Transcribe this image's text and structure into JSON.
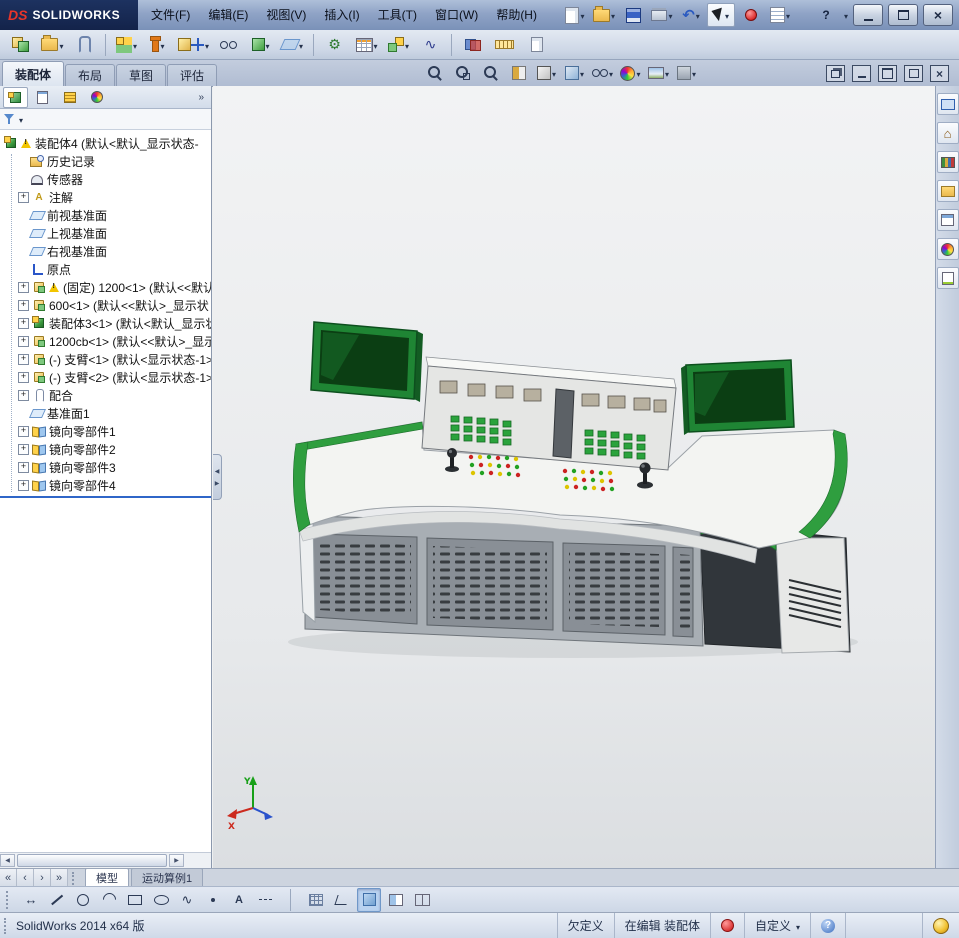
{
  "titlebar": {
    "logo_mark": "DS",
    "brand": "SOLIDWORKS",
    "menus": [
      {
        "label": "文件(F)"
      },
      {
        "label": "编辑(E)"
      },
      {
        "label": "视图(V)"
      },
      {
        "label": "插入(I)"
      },
      {
        "label": "工具(T)"
      },
      {
        "label": "窗口(W)"
      },
      {
        "label": "帮助(H)"
      }
    ]
  },
  "quick_toolbar": {
    "icons": [
      "new-document",
      "open-document",
      "save",
      "print",
      "undo",
      "select",
      "record-macro",
      "options-list"
    ]
  },
  "assembly_toolbar": {
    "icons": [
      "edit-component",
      "insert-components",
      "mate",
      "linear-component-pattern",
      "smart-fasteners",
      "move-component",
      "show-hidden-components",
      "assembly-features",
      "reference-geometry",
      "new-motion-study",
      "bill-of-materials",
      "exploded-view",
      "explode-line-sketch",
      "interference-detection",
      "measure",
      "performance-evaluation"
    ]
  },
  "command_tabs": {
    "tabs": [
      {
        "label": "装配体",
        "active": true
      },
      {
        "label": "布局",
        "active": false
      },
      {
        "label": "草图",
        "active": false
      },
      {
        "label": "评估",
        "active": false
      }
    ]
  },
  "headsup": {
    "icons": [
      "zoom-to-fit",
      "zoom-to-area",
      "previous-view",
      "section-view",
      "view-orientation",
      "display-style",
      "hide-show-items",
      "edit-appearance",
      "apply-scene",
      "view-settings"
    ]
  },
  "viewport_window_buttons": [
    "restore-window",
    "minimize-window",
    "maximize-window",
    "float-window",
    "close-window"
  ],
  "feature_panel": {
    "tabs": [
      "featuremanager",
      "propertymanager",
      "configurationmanager",
      "displaymanager"
    ],
    "tree": [
      {
        "text": "装配体4 (默认<默认_显示状态-",
        "icon": "assembly",
        "warning": true
      },
      {
        "text": "历史记录",
        "icon": "history"
      },
      {
        "text": "传感器",
        "icon": "sensors"
      },
      {
        "text": "注解",
        "icon": "annotations",
        "expandable": true
      },
      {
        "text": "前视基准面",
        "icon": "plane"
      },
      {
        "text": "上视基准面",
        "icon": "plane"
      },
      {
        "text": "右视基准面",
        "icon": "plane"
      },
      {
        "text": "原点",
        "icon": "origin"
      },
      {
        "text": "(固定) 1200<1> (默认<<默认",
        "icon": "part",
        "warning": true,
        "expandable": true
      },
      {
        "text": "600<1> (默认<<默认>_显示状",
        "icon": "part",
        "expandable": true
      },
      {
        "text": "装配体3<1> (默认<默认_显示状",
        "icon": "assembly",
        "expandable": true
      },
      {
        "text": "1200cb<1> (默认<<默认>_显示",
        "icon": "part",
        "expandable": true
      },
      {
        "text": "(-) 支臂<1> (默认<显示状态-1>",
        "icon": "part",
        "expandable": true
      },
      {
        "text": "(-) 支臂<2> (默认<显示状态-1>",
        "icon": "part",
        "expandable": true
      },
      {
        "text": "配合",
        "icon": "mates",
        "expandable": true
      },
      {
        "text": "基准面1",
        "icon": "plane"
      },
      {
        "text": "镜向零部件1",
        "icon": "mirror",
        "expandable": true
      },
      {
        "text": "镜向零部件2",
        "icon": "mirror",
        "expandable": true
      },
      {
        "text": "镜向零部件3",
        "icon": "mirror",
        "expandable": true
      },
      {
        "text": "镜向零部件4",
        "icon": "mirror",
        "expandable": true
      }
    ]
  },
  "task_pane": {
    "icons": [
      "solidworks-resources",
      "home",
      "design-library",
      "file-explorer",
      "view-palette",
      "appearances-scenes",
      "custom-properties"
    ]
  },
  "triad": {
    "x": "X",
    "y": "Y"
  },
  "bottom": {
    "tabs": [
      {
        "label": "模型",
        "active": true
      },
      {
        "label": "运动算例1",
        "active": false
      }
    ],
    "sketch_icons": [
      "smart-dimension",
      "line",
      "circle",
      "arc",
      "rectangle",
      "ellipse",
      "spline",
      "point",
      "text",
      "centerline",
      "grid",
      "angle-snap",
      "shaded-sketch-contours",
      "section-view",
      "two-pane-view"
    ],
    "pressed": [
      "shaded-sketch-contours"
    ]
  },
  "statusbar": {
    "app": "SolidWorks 2014 x64 版",
    "state": "欠定义",
    "editing": "在编辑 装配体",
    "custom": "自定义"
  },
  "colors": {
    "accent_green": "#2f9e3f",
    "monitor_green": "#1f8534",
    "selection_blue": "#2f66c8",
    "titlebar_navy": "#15244c"
  }
}
